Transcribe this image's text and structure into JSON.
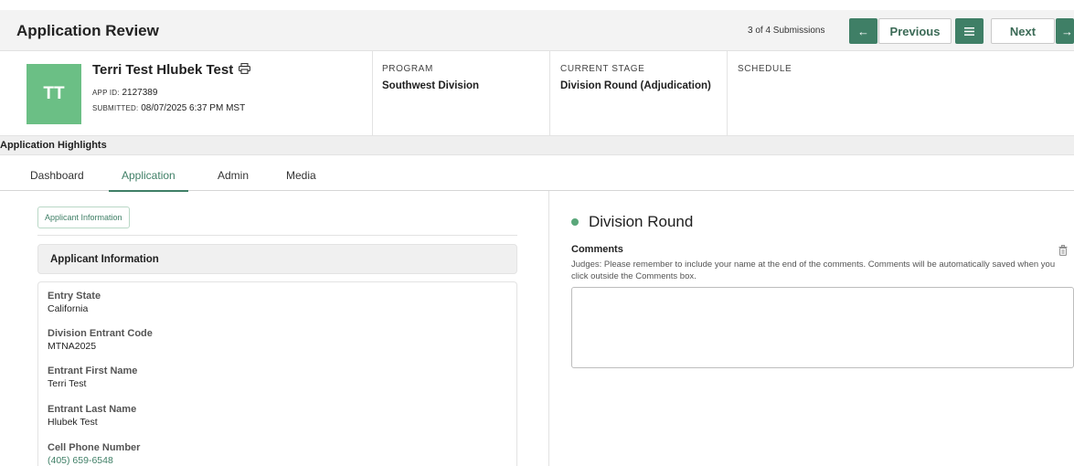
{
  "header": {
    "title": "Application Review",
    "submission_count": "3 of 4 Submissions",
    "prev_label": "Previous",
    "next_label": "Next"
  },
  "applicant": {
    "initials": "TT",
    "name": "Terri Test Hlubek Test",
    "app_id_label": "APP ID:",
    "app_id": "2127389",
    "submitted_label": "SUBMITTED:",
    "submitted": "08/07/2025 6:37 PM MST"
  },
  "columns": [
    {
      "label": "PROGRAM",
      "value": "Southwest Division"
    },
    {
      "label": "CURRENT STAGE",
      "value": "Division Round (Adjudication)"
    },
    {
      "label": "SCHEDULE",
      "value": ""
    }
  ],
  "highlights_label": "Application Highlights",
  "tabs": [
    {
      "label": "Dashboard",
      "active": false
    },
    {
      "label": "Application",
      "active": true
    },
    {
      "label": "Admin",
      "active": false
    },
    {
      "label": "Media",
      "active": false
    }
  ],
  "left": {
    "chip": "Applicant Information",
    "section_title": "Applicant Information",
    "fields": [
      {
        "label": "Entry State",
        "value": "California"
      },
      {
        "label": "Division Entrant Code",
        "value": "MTNA2025"
      },
      {
        "label": "Entrant First Name",
        "value": "Terri Test"
      },
      {
        "label": "Entrant Last Name",
        "value": "Hlubek Test"
      },
      {
        "label": "Cell Phone Number",
        "value": "(405) 659-6548"
      }
    ]
  },
  "right": {
    "round_title": "Division Round",
    "comments_label": "Comments",
    "comments_help": "Judges: Please remember to include your name at the end of the comments. Comments will be automatically saved when you click outside the Comments box.",
    "comments_value": ""
  },
  "colors": {
    "accent": "#3f7f66",
    "avatar": "#6bbf85"
  }
}
